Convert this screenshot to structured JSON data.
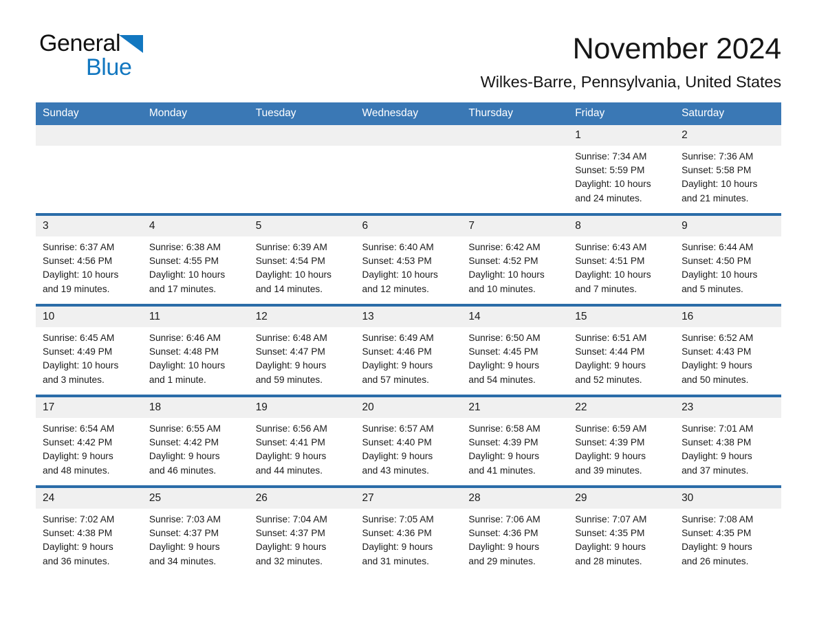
{
  "brand": {
    "name_part1": "General",
    "name_part2": "Blue",
    "triangle_icon": "triangle-icon",
    "accent_color": "#1277c0"
  },
  "header": {
    "month_title": "November 2024",
    "location": "Wilkes-Barre, Pennsylvania, United States"
  },
  "colors": {
    "header_blue": "#3a78b5",
    "separator_blue": "#2b6ca8",
    "daynum_band": "#f0f0f0",
    "text": "#1a1a1a"
  },
  "weekday_headers": [
    "Sunday",
    "Monday",
    "Tuesday",
    "Wednesday",
    "Thursday",
    "Friday",
    "Saturday"
  ],
  "weeks": [
    {
      "days": [
        {
          "num": "",
          "empty": true,
          "sunrise": "",
          "sunset": "",
          "daylight_line1": "",
          "daylight_line2": ""
        },
        {
          "num": "",
          "empty": true,
          "sunrise": "",
          "sunset": "",
          "daylight_line1": "",
          "daylight_line2": ""
        },
        {
          "num": "",
          "empty": true,
          "sunrise": "",
          "sunset": "",
          "daylight_line1": "",
          "daylight_line2": ""
        },
        {
          "num": "",
          "empty": true,
          "sunrise": "",
          "sunset": "",
          "daylight_line1": "",
          "daylight_line2": ""
        },
        {
          "num": "",
          "empty": true,
          "sunrise": "",
          "sunset": "",
          "daylight_line1": "",
          "daylight_line2": ""
        },
        {
          "num": "1",
          "empty": false,
          "sunrise": "Sunrise: 7:34 AM",
          "sunset": "Sunset: 5:59 PM",
          "daylight_line1": "Daylight: 10 hours",
          "daylight_line2": "and 24 minutes."
        },
        {
          "num": "2",
          "empty": false,
          "sunrise": "Sunrise: 7:36 AM",
          "sunset": "Sunset: 5:58 PM",
          "daylight_line1": "Daylight: 10 hours",
          "daylight_line2": "and 21 minutes."
        }
      ]
    },
    {
      "days": [
        {
          "num": "3",
          "empty": false,
          "sunrise": "Sunrise: 6:37 AM",
          "sunset": "Sunset: 4:56 PM",
          "daylight_line1": "Daylight: 10 hours",
          "daylight_line2": "and 19 minutes."
        },
        {
          "num": "4",
          "empty": false,
          "sunrise": "Sunrise: 6:38 AM",
          "sunset": "Sunset: 4:55 PM",
          "daylight_line1": "Daylight: 10 hours",
          "daylight_line2": "and 17 minutes."
        },
        {
          "num": "5",
          "empty": false,
          "sunrise": "Sunrise: 6:39 AM",
          "sunset": "Sunset: 4:54 PM",
          "daylight_line1": "Daylight: 10 hours",
          "daylight_line2": "and 14 minutes."
        },
        {
          "num": "6",
          "empty": false,
          "sunrise": "Sunrise: 6:40 AM",
          "sunset": "Sunset: 4:53 PM",
          "daylight_line1": "Daylight: 10 hours",
          "daylight_line2": "and 12 minutes."
        },
        {
          "num": "7",
          "empty": false,
          "sunrise": "Sunrise: 6:42 AM",
          "sunset": "Sunset: 4:52 PM",
          "daylight_line1": "Daylight: 10 hours",
          "daylight_line2": "and 10 minutes."
        },
        {
          "num": "8",
          "empty": false,
          "sunrise": "Sunrise: 6:43 AM",
          "sunset": "Sunset: 4:51 PM",
          "daylight_line1": "Daylight: 10 hours",
          "daylight_line2": "and 7 minutes."
        },
        {
          "num": "9",
          "empty": false,
          "sunrise": "Sunrise: 6:44 AM",
          "sunset": "Sunset: 4:50 PM",
          "daylight_line1": "Daylight: 10 hours",
          "daylight_line2": "and 5 minutes."
        }
      ]
    },
    {
      "days": [
        {
          "num": "10",
          "empty": false,
          "sunrise": "Sunrise: 6:45 AM",
          "sunset": "Sunset: 4:49 PM",
          "daylight_line1": "Daylight: 10 hours",
          "daylight_line2": "and 3 minutes."
        },
        {
          "num": "11",
          "empty": false,
          "sunrise": "Sunrise: 6:46 AM",
          "sunset": "Sunset: 4:48 PM",
          "daylight_line1": "Daylight: 10 hours",
          "daylight_line2": "and 1 minute."
        },
        {
          "num": "12",
          "empty": false,
          "sunrise": "Sunrise: 6:48 AM",
          "sunset": "Sunset: 4:47 PM",
          "daylight_line1": "Daylight: 9 hours",
          "daylight_line2": "and 59 minutes."
        },
        {
          "num": "13",
          "empty": false,
          "sunrise": "Sunrise: 6:49 AM",
          "sunset": "Sunset: 4:46 PM",
          "daylight_line1": "Daylight: 9 hours",
          "daylight_line2": "and 57 minutes."
        },
        {
          "num": "14",
          "empty": false,
          "sunrise": "Sunrise: 6:50 AM",
          "sunset": "Sunset: 4:45 PM",
          "daylight_line1": "Daylight: 9 hours",
          "daylight_line2": "and 54 minutes."
        },
        {
          "num": "15",
          "empty": false,
          "sunrise": "Sunrise: 6:51 AM",
          "sunset": "Sunset: 4:44 PM",
          "daylight_line1": "Daylight: 9 hours",
          "daylight_line2": "and 52 minutes."
        },
        {
          "num": "16",
          "empty": false,
          "sunrise": "Sunrise: 6:52 AM",
          "sunset": "Sunset: 4:43 PM",
          "daylight_line1": "Daylight: 9 hours",
          "daylight_line2": "and 50 minutes."
        }
      ]
    },
    {
      "days": [
        {
          "num": "17",
          "empty": false,
          "sunrise": "Sunrise: 6:54 AM",
          "sunset": "Sunset: 4:42 PM",
          "daylight_line1": "Daylight: 9 hours",
          "daylight_line2": "and 48 minutes."
        },
        {
          "num": "18",
          "empty": false,
          "sunrise": "Sunrise: 6:55 AM",
          "sunset": "Sunset: 4:42 PM",
          "daylight_line1": "Daylight: 9 hours",
          "daylight_line2": "and 46 minutes."
        },
        {
          "num": "19",
          "empty": false,
          "sunrise": "Sunrise: 6:56 AM",
          "sunset": "Sunset: 4:41 PM",
          "daylight_line1": "Daylight: 9 hours",
          "daylight_line2": "and 44 minutes."
        },
        {
          "num": "20",
          "empty": false,
          "sunrise": "Sunrise: 6:57 AM",
          "sunset": "Sunset: 4:40 PM",
          "daylight_line1": "Daylight: 9 hours",
          "daylight_line2": "and 43 minutes."
        },
        {
          "num": "21",
          "empty": false,
          "sunrise": "Sunrise: 6:58 AM",
          "sunset": "Sunset: 4:39 PM",
          "daylight_line1": "Daylight: 9 hours",
          "daylight_line2": "and 41 minutes."
        },
        {
          "num": "22",
          "empty": false,
          "sunrise": "Sunrise: 6:59 AM",
          "sunset": "Sunset: 4:39 PM",
          "daylight_line1": "Daylight: 9 hours",
          "daylight_line2": "and 39 minutes."
        },
        {
          "num": "23",
          "empty": false,
          "sunrise": "Sunrise: 7:01 AM",
          "sunset": "Sunset: 4:38 PM",
          "daylight_line1": "Daylight: 9 hours",
          "daylight_line2": "and 37 minutes."
        }
      ]
    },
    {
      "days": [
        {
          "num": "24",
          "empty": false,
          "sunrise": "Sunrise: 7:02 AM",
          "sunset": "Sunset: 4:38 PM",
          "daylight_line1": "Daylight: 9 hours",
          "daylight_line2": "and 36 minutes."
        },
        {
          "num": "25",
          "empty": false,
          "sunrise": "Sunrise: 7:03 AM",
          "sunset": "Sunset: 4:37 PM",
          "daylight_line1": "Daylight: 9 hours",
          "daylight_line2": "and 34 minutes."
        },
        {
          "num": "26",
          "empty": false,
          "sunrise": "Sunrise: 7:04 AM",
          "sunset": "Sunset: 4:37 PM",
          "daylight_line1": "Daylight: 9 hours",
          "daylight_line2": "and 32 minutes."
        },
        {
          "num": "27",
          "empty": false,
          "sunrise": "Sunrise: 7:05 AM",
          "sunset": "Sunset: 4:36 PM",
          "daylight_line1": "Daylight: 9 hours",
          "daylight_line2": "and 31 minutes."
        },
        {
          "num": "28",
          "empty": false,
          "sunrise": "Sunrise: 7:06 AM",
          "sunset": "Sunset: 4:36 PM",
          "daylight_line1": "Daylight: 9 hours",
          "daylight_line2": "and 29 minutes."
        },
        {
          "num": "29",
          "empty": false,
          "sunrise": "Sunrise: 7:07 AM",
          "sunset": "Sunset: 4:35 PM",
          "daylight_line1": "Daylight: 9 hours",
          "daylight_line2": "and 28 minutes."
        },
        {
          "num": "30",
          "empty": false,
          "sunrise": "Sunrise: 7:08 AM",
          "sunset": "Sunset: 4:35 PM",
          "daylight_line1": "Daylight: 9 hours",
          "daylight_line2": "and 26 minutes."
        }
      ]
    }
  ]
}
